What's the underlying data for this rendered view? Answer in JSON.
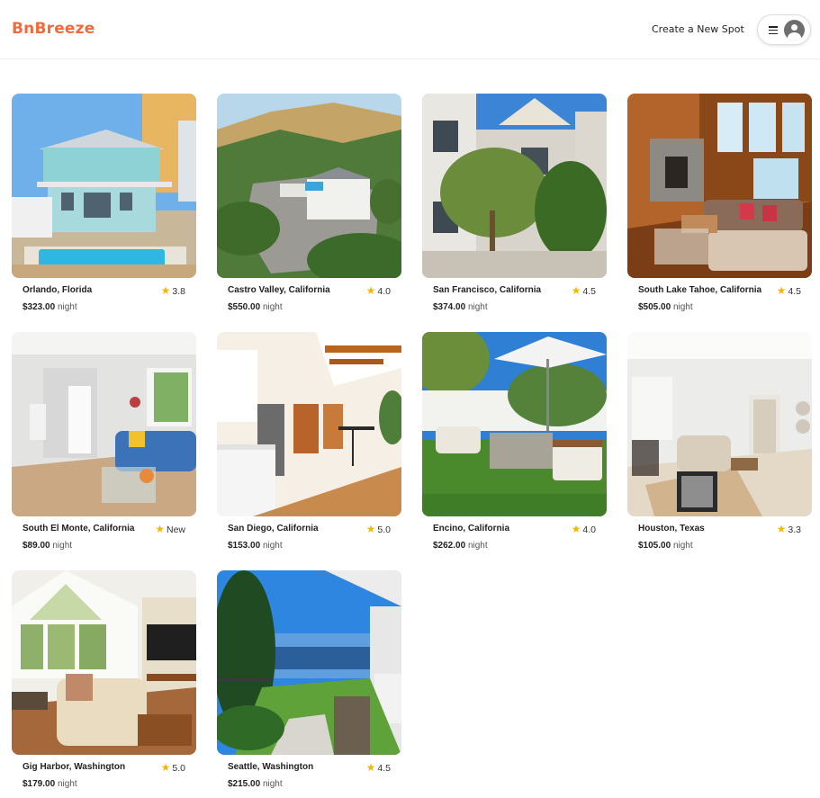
{
  "header": {
    "logo": "BnBreeze",
    "create_spot": "Create a New Spot",
    "menu_icon": "hamburger-icon",
    "avatar_icon": "user-avatar-icon"
  },
  "colors": {
    "brand": "#ef6c3a",
    "star": "#f5b800"
  },
  "price_suffix": "night",
  "spots": [
    {
      "location": "Orlando, Florida",
      "rating": "3.8",
      "price": "$323.00",
      "scene": "pool-house"
    },
    {
      "location": "Castro Valley, California",
      "rating": "4.0",
      "price": "$550.00",
      "scene": "aerial-hills"
    },
    {
      "location": "San Francisco, California",
      "rating": "4.5",
      "price": "$374.00",
      "scene": "victorian"
    },
    {
      "location": "South Lake Tahoe, California",
      "rating": "4.5",
      "price": "$505.00",
      "scene": "cabin-living"
    },
    {
      "location": "South El Monte, California",
      "rating": "New",
      "price": "$89.00",
      "scene": "modern-living"
    },
    {
      "location": "San Diego, California",
      "rating": "5.0",
      "price": "$153.00",
      "scene": "kitchen"
    },
    {
      "location": "Encino, California",
      "rating": "4.0",
      "price": "$262.00",
      "scene": "patio"
    },
    {
      "location": "Houston, Texas",
      "rating": "3.3",
      "price": "$105.00",
      "scene": "bright-living"
    },
    {
      "location": "Gig Harbor, Washington",
      "rating": "5.0",
      "price": "$179.00",
      "scene": "vaulted-living"
    },
    {
      "location": "Seattle, Washington",
      "rating": "4.5",
      "price": "$215.00",
      "scene": "ocean-yard"
    }
  ]
}
